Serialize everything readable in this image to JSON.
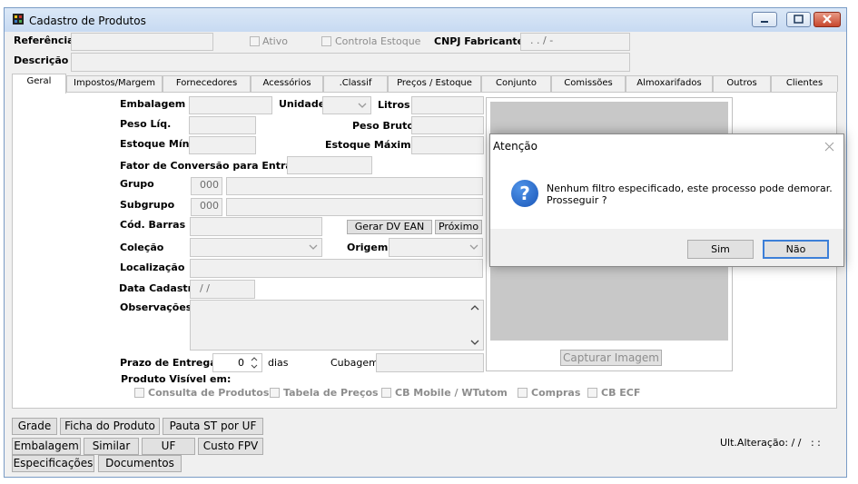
{
  "window": {
    "title": "Cadastro de Produtos"
  },
  "header": {
    "referencia_label": "Referência",
    "ativo_label": "Ativo",
    "controla_estoque_label": "Controla Estoque",
    "cnpj_label": "CNPJ Fabricante",
    "cnpj_value": ". . / -",
    "descricao_label": "Descrição"
  },
  "tabs": [
    {
      "label": "Geral",
      "active": true
    },
    {
      "label": "Impostos/Margem"
    },
    {
      "label": "Fornecedores"
    },
    {
      "label": "Acessórios"
    },
    {
      "label": ".Classif"
    },
    {
      "label": "Preços / Estoque"
    },
    {
      "label": "Conjunto"
    },
    {
      "label": "Comissões"
    },
    {
      "label": "Almoxarifados"
    },
    {
      "label": "Outros"
    },
    {
      "label": "Clientes"
    }
  ],
  "geral": {
    "embalagem": "Embalagem",
    "unidade": "Unidade",
    "litros": "Litros",
    "peso_liq": "Peso Líq.",
    "peso_bruto": "Peso Bruto",
    "estoque_min": "Estoque Mín.",
    "estoque_max": "Estoque Máximo",
    "fator_conversao": "Fator de Conversão para Entrada",
    "grupo": "Grupo",
    "grupo_code": "000",
    "subgrupo": "Subgrupo",
    "subgrupo_code": "000",
    "cod_barras": "Cód. Barras",
    "gerar_dv_ean": "Gerar DV EAN",
    "proximo": "Próximo",
    "colecao": "Coleção",
    "origem": "Origem",
    "localizacao": "Localização",
    "data_cadastro": "Data Cadastro",
    "data_cadastro_value": "/ /",
    "observacoes": "Observações",
    "prazo_entrega": "Prazo de Entrega",
    "prazo_value": "0",
    "dias": "dias",
    "cubagem": "Cubagem",
    "produto_visivel": "Produto Visível em:",
    "visivel_opcoes": [
      "Consulta de Produtos",
      "Tabela de Preços",
      "CB Mobile / WTutom",
      "Compras",
      "CB ECF"
    ],
    "capturar_imagem": "Capturar Imagem"
  },
  "bottom_buttons": {
    "grade": "Grade",
    "ficha_produto": "Ficha do Produto",
    "pauta_st": "Pauta ST por UF",
    "embalagem": "Embalagem",
    "similar": "Similar",
    "uf": "UF",
    "custo_fpv": "Custo FPV",
    "especificacoes": "Especificações",
    "documentos": "Documentos"
  },
  "ult_alteracao": "Ult.Alteração: / /   : :",
  "dialog": {
    "title": "Atenção",
    "message_line1": "Nenhum filtro especificado, este processo pode demorar.",
    "message_line2": "Prosseguir ?",
    "sim": "Sim",
    "nao": "Não"
  }
}
